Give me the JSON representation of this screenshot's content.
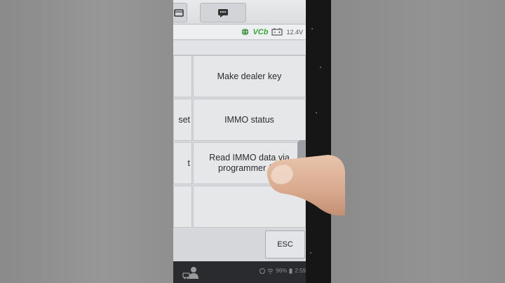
{
  "status": {
    "vci_label": "VCb",
    "voltage": "12.4V"
  },
  "menu": {
    "rows": [
      {
        "left": "",
        "right": "Make dealer key"
      },
      {
        "left": "set",
        "right": "IMMO status"
      },
      {
        "left": "t",
        "right": "Read IMMO data via programmer (ex"
      },
      {
        "left": "",
        "right": ""
      }
    ]
  },
  "footer": {
    "esc_label": "ESC"
  },
  "navbar": {
    "battery": "96%",
    "time": "2:59"
  },
  "icons": {
    "top1": "folder-icon",
    "top2": "message-icon",
    "globe": "globe-icon",
    "battery": "car-battery-icon",
    "user": "technician-icon"
  },
  "colors": {
    "vci_green": "#3aa53a",
    "screen_bg": "#d8d9dc"
  }
}
